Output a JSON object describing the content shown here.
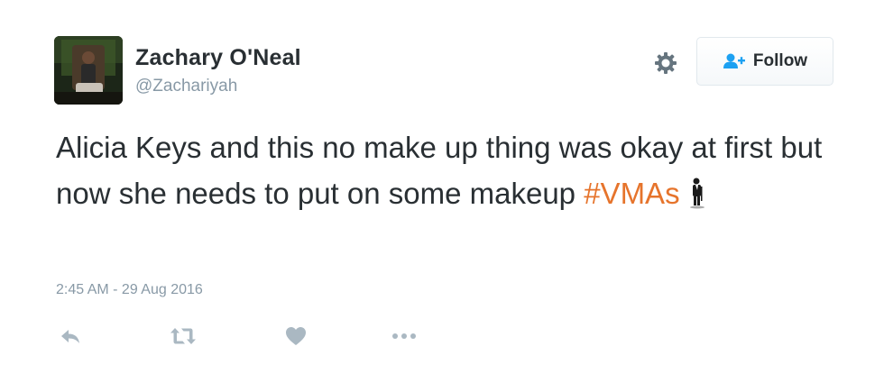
{
  "user": {
    "display_name": "Zachary O'Neal",
    "handle": "@Zachariyah"
  },
  "follow_button": {
    "label": "Follow"
  },
  "tweet": {
    "text_main": "Alicia Keys and this no make up thing was okay at first but now she needs to put on some makeup ",
    "hashtag": "#VMAs",
    "emoji": "man-in-suit-levitating",
    "timestamp": "2:45 AM - 29 Aug 2016"
  },
  "icons": {
    "settings": "gear-icon",
    "follow": "add-user-icon",
    "reply": "reply-icon",
    "retweet": "retweet-icon",
    "like": "heart-icon",
    "more": "more-icon"
  },
  "colors": {
    "text": "#292f33",
    "secondary": "#8899a6",
    "hashtag": "#e6742c",
    "follow_icon": "#1da1f2",
    "action_icon": "#aab8c2"
  }
}
